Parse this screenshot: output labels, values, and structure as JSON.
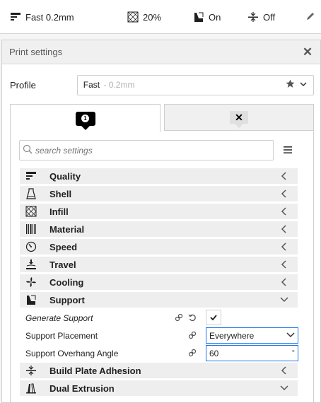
{
  "topbar": {
    "profile_label": "Fast 0.2mm",
    "infill_label": "20%",
    "support_label": "On",
    "adhesion_label": "Off"
  },
  "panel": {
    "title": "Print settings",
    "profile_label": "Profile",
    "profile_name": "Fast",
    "profile_sub": " - 0.2mm",
    "tab_badge": "1"
  },
  "search": {
    "placeholder": "search settings"
  },
  "categories": [
    {
      "label": "Quality",
      "icon": "quality-icon",
      "expanded": false
    },
    {
      "label": "Shell",
      "icon": "shell-icon",
      "expanded": false
    },
    {
      "label": "Infill",
      "icon": "infill-icon",
      "expanded": false
    },
    {
      "label": "Material",
      "icon": "material-icon",
      "expanded": false
    },
    {
      "label": "Speed",
      "icon": "speed-icon",
      "expanded": false
    },
    {
      "label": "Travel",
      "icon": "travel-icon",
      "expanded": false
    },
    {
      "label": "Cooling",
      "icon": "cooling-icon",
      "expanded": false
    },
    {
      "label": "Support",
      "icon": "support-icon",
      "expanded": true
    },
    {
      "label": "Build Plate Adhesion",
      "icon": "adhesion-icon",
      "expanded": false
    },
    {
      "label": "Dual Extrusion",
      "icon": "dual-extrusion-icon",
      "expanded": true
    }
  ],
  "support_settings": {
    "generate_support_label": "Generate Support",
    "generate_support_checked": true,
    "placement_label": "Support Placement",
    "placement_value": "Everywhere",
    "overhang_label": "Support Overhang Angle",
    "overhang_value": "60",
    "overhang_unit": "°"
  },
  "colors": {
    "accent": "#1a73e8",
    "category_bg": "#eeeeee"
  }
}
